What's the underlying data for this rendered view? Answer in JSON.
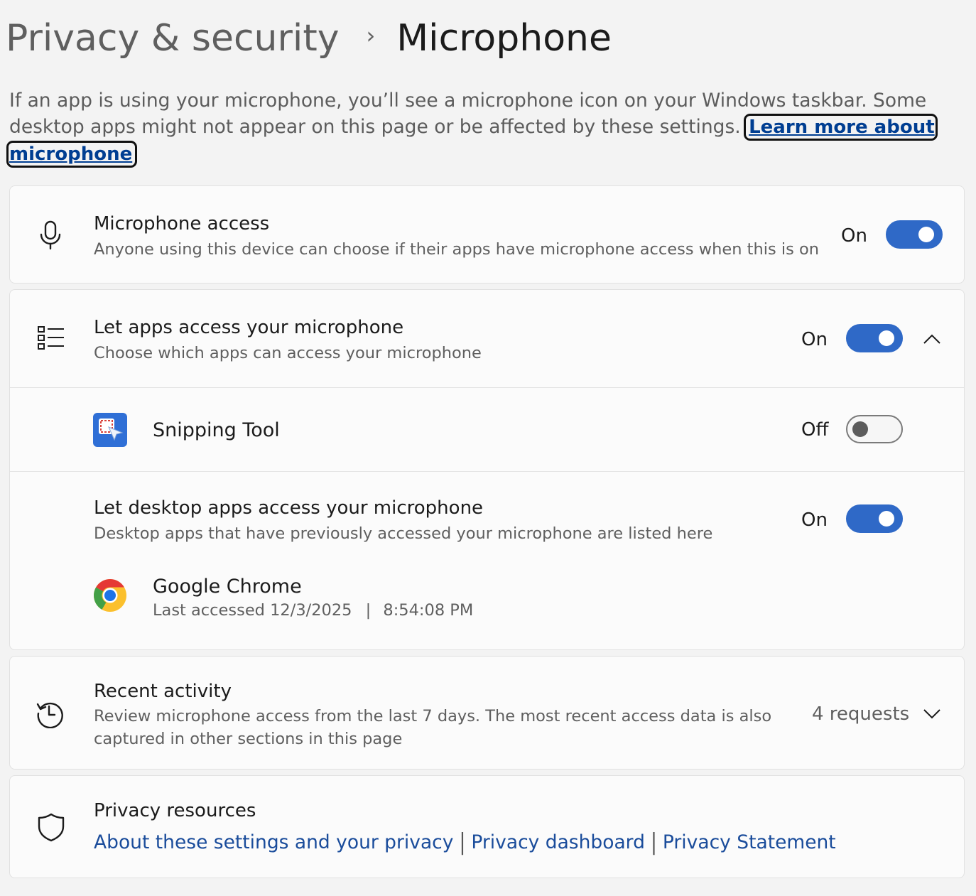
{
  "breadcrumb": {
    "parent": "Privacy & security",
    "separator": "›",
    "current": "Microphone"
  },
  "intro": {
    "text": "If an app is using your microphone, you’ll see a microphone icon on your Windows taskbar. Some desktop apps might not appear on this page or be affected by these settings. ",
    "link": "Learn more about microphone"
  },
  "mic_access": {
    "icon": "microphone-icon",
    "title": "Microphone access",
    "desc": "Anyone using this device can choose if their apps have microphone access when this is on",
    "state": "On",
    "on": true
  },
  "apps_access": {
    "icon": "list-icon",
    "title": "Let apps access your microphone",
    "desc": "Choose which apps can access your microphone",
    "state": "On",
    "on": true,
    "expanded": true,
    "apps": [
      {
        "icon": "snipping-tool-icon",
        "name": "Snipping Tool",
        "state": "Off",
        "on": false
      }
    ],
    "desktop": {
      "title": "Let desktop apps access your microphone",
      "desc": "Desktop apps that have previously accessed your microphone are listed here",
      "state": "On",
      "on": true,
      "apps": [
        {
          "icon": "chrome-icon",
          "name": "Google Chrome",
          "last_accessed_label": "Last accessed 12/3/2025",
          "divider": "|",
          "time": "8:54:08 PM"
        }
      ]
    }
  },
  "recent_activity": {
    "icon": "history-icon",
    "title": "Recent activity",
    "desc_line1": "Review microphone access from the last 7 days. The most recent access data is also",
    "desc_line2": "captured in other sections in this page",
    "count": "4 requests"
  },
  "privacy_resources": {
    "icon": "shield-icon",
    "title": "Privacy resources",
    "links": [
      "About these settings and your privacy",
      "Privacy dashboard",
      "Privacy Statement"
    ],
    "separator": "|"
  },
  "colors": {
    "accent": "#2f69c7",
    "link": "#1a4c9b",
    "background": "#f3f3f3",
    "card": "#fbfbfb"
  }
}
